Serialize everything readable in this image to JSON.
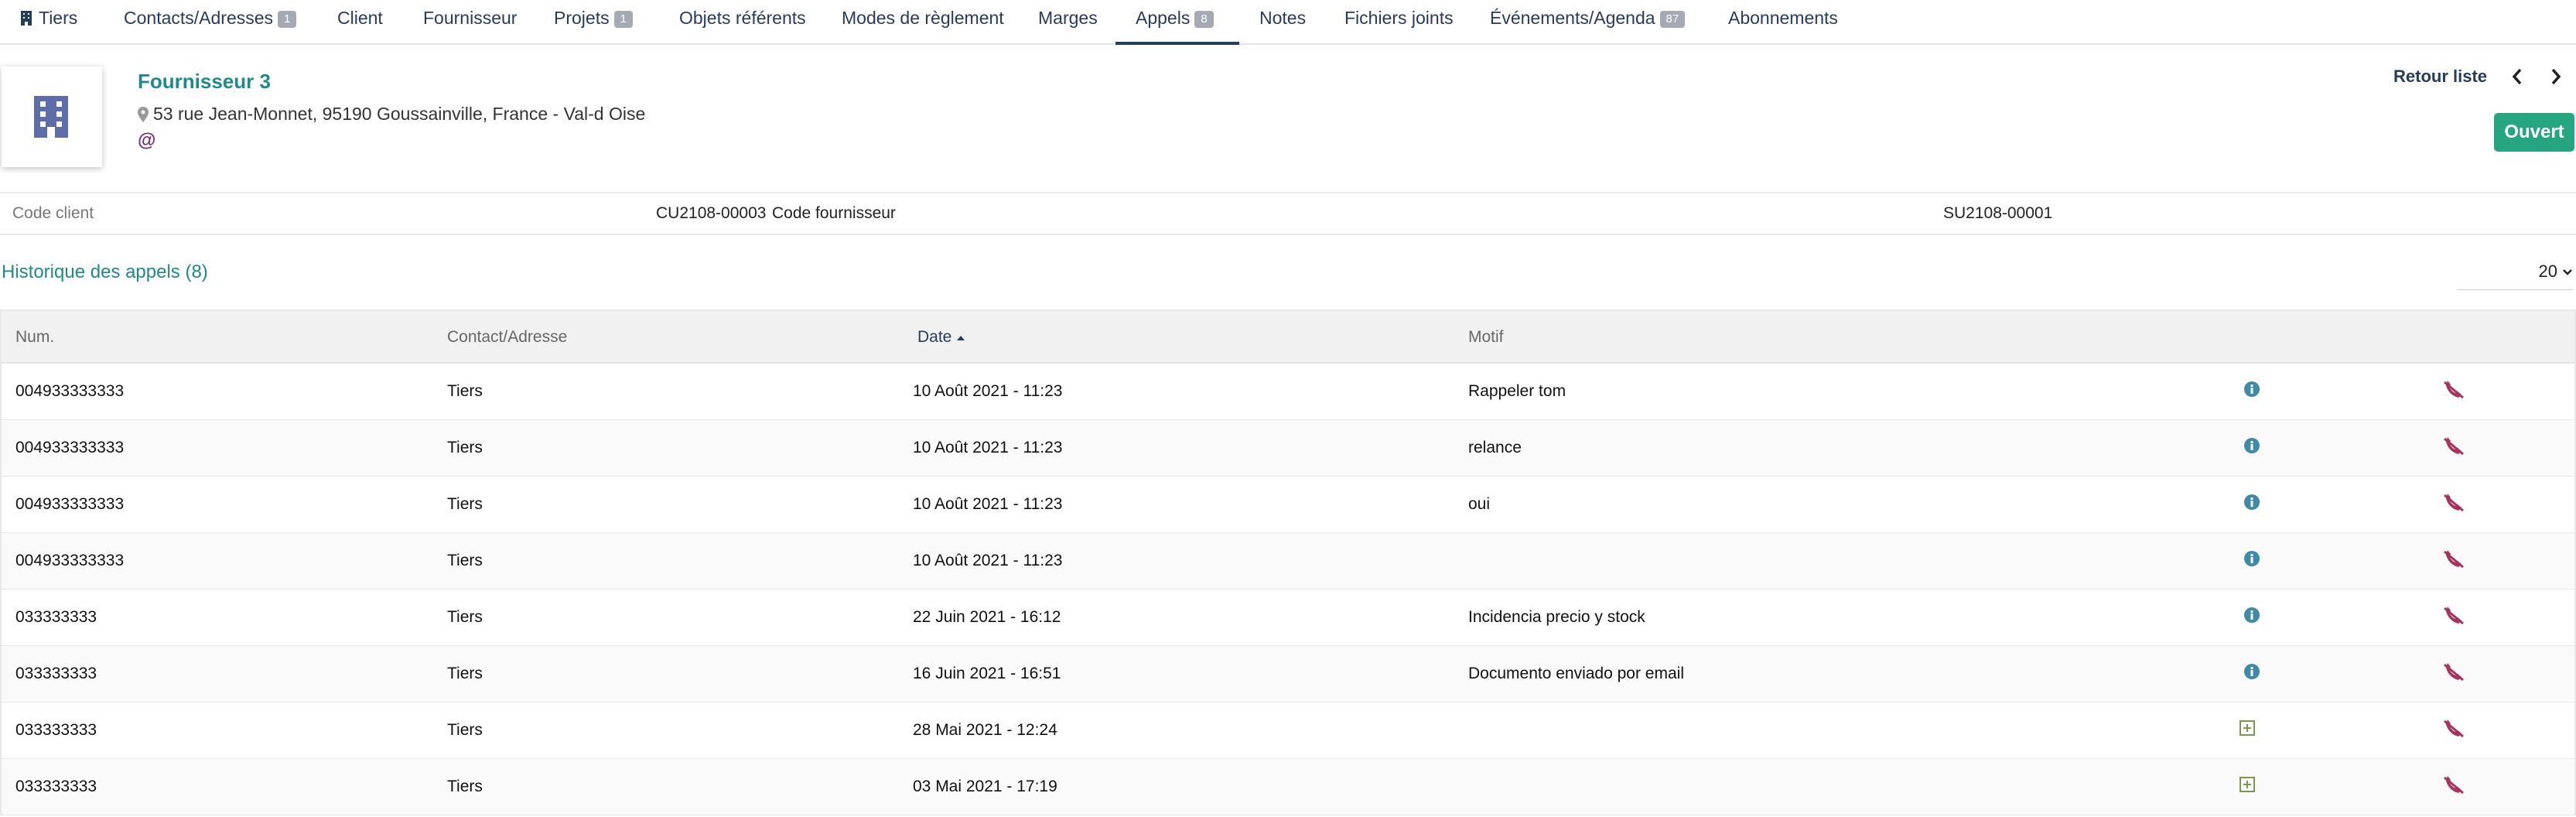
{
  "tabs": [
    {
      "label": "Tiers",
      "badge": ""
    },
    {
      "label": "Contacts/Adresses",
      "badge": "1"
    },
    {
      "label": "Client",
      "badge": ""
    },
    {
      "label": "Fournisseur",
      "badge": ""
    },
    {
      "label": "Projets",
      "badge": "1"
    },
    {
      "label": "Objets référents",
      "badge": ""
    },
    {
      "label": "Modes de règlement",
      "badge": ""
    },
    {
      "label": "Marges",
      "badge": ""
    },
    {
      "label": "Appels",
      "badge": "8",
      "active": true
    },
    {
      "label": "Notes",
      "badge": ""
    },
    {
      "label": "Fichiers joints",
      "badge": ""
    },
    {
      "label": "Événements/Agenda",
      "badge": "87"
    },
    {
      "label": "Abonnements",
      "badge": ""
    }
  ],
  "header": {
    "name": "Fournisseur 3",
    "address": "53 rue Jean-Monnet, 95190 Goussainville, France - Val-d Oise",
    "email_symbol": "@",
    "back_label": "Retour liste",
    "status": "Ouvert"
  },
  "info": {
    "client_code_label": "Code client",
    "client_code_value": "CU2108-00003",
    "supplier_code_label": "Code fournisseur",
    "supplier_code_value": "SU2108-00001"
  },
  "calls": {
    "title": "Historique des appels (8)",
    "limit": "20",
    "columns": {
      "num": "Num.",
      "contact": "Contact/Adresse",
      "date": "Date",
      "motif": "Motif"
    },
    "rows": [
      {
        "num": "004933333333",
        "contact": "Tiers",
        "date": "10 Août 2021 - 11:23",
        "motif": "Rappeler tom",
        "info_icon": "info-icon"
      },
      {
        "num": "004933333333",
        "contact": "Tiers",
        "date": "10 Août 2021 - 11:23",
        "motif": "relance",
        "info_icon": "info-icon"
      },
      {
        "num": "004933333333",
        "contact": "Tiers",
        "date": "10 Août 2021 - 11:23",
        "motif": "oui",
        "info_icon": "info-icon"
      },
      {
        "num": "004933333333",
        "contact": "Tiers",
        "date": "10 Août 2021 - 11:23",
        "motif": "",
        "info_icon": "info-icon"
      },
      {
        "num": "033333333",
        "contact": "Tiers",
        "date": "22 Juin 2021 - 16:12",
        "motif": "Incidencia precio y stock",
        "info_icon": "info-icon"
      },
      {
        "num": "033333333",
        "contact": "Tiers",
        "date": "16 Juin 2021 - 16:51",
        "motif": "Documento enviado por email",
        "info_icon": "info-icon"
      },
      {
        "num": "033333333",
        "contact": "Tiers",
        "date": "28 Mai 2021 - 12:24",
        "motif": "",
        "info_icon": "plus-square-icon"
      },
      {
        "num": "033333333",
        "contact": "Tiers",
        "date": "03 Mai 2021 - 17:19",
        "motif": "",
        "info_icon": "plus-square-icon"
      }
    ]
  },
  "colors": {
    "accent": "#1f8a8a",
    "nav": "#263c5c",
    "status": "#25a580",
    "hangup": "#a8325e",
    "info": "#3e8aa8"
  }
}
